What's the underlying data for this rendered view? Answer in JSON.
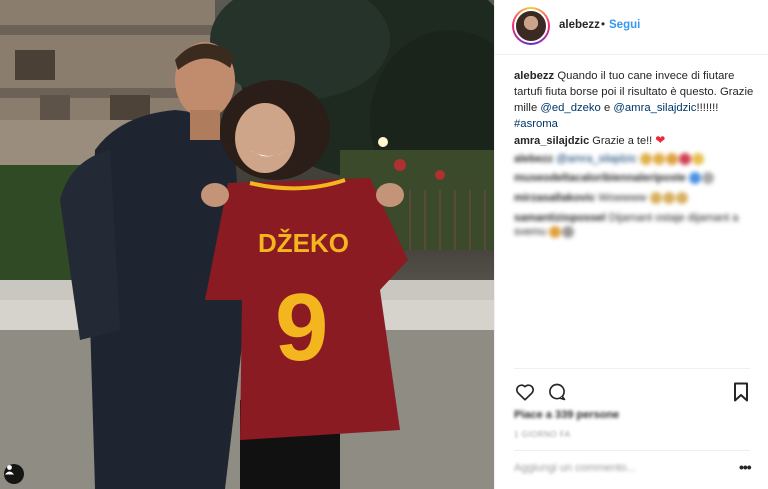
{
  "photo": {
    "jersey_name": "DŽEKO",
    "jersey_number": "9",
    "user_tag_icon": "person-icon"
  },
  "header": {
    "username": "alebezz",
    "separator": "•",
    "follow_label": "Segui"
  },
  "caption": {
    "username": "alebezz",
    "text_part1": "Quando il tuo cane invece di fiutare tartufi fiuta borse poi il risultato è questo. Grazie mille ",
    "mention1": "@ed_dzeko",
    "text_part2": " e ",
    "mention2": "@amra_silajdzic",
    "text_part3": "!!!!!!! ",
    "hashtag": "#asroma"
  },
  "comments": [
    {
      "username": "amra_silajdzic",
      "text": "Grazie a te!!",
      "emoji": "❤"
    },
    {
      "username": "alebezz",
      "text": "@amra_silajdzic",
      "blurred": true
    },
    {
      "username": "museodeltacaloribiennaleriposte",
      "text": "",
      "blurred": true
    },
    {
      "username": "mirzasallakovic",
      "text": "Wowwww",
      "blurred": true
    },
    {
      "username": "samantiziopossel",
      "text": "Dijamant ostaje dijamant a svemu",
      "blurred": true
    }
  ],
  "actions": {
    "like_icon": "heart-icon",
    "comment_icon": "comment-icon",
    "save_icon": "bookmark-icon"
  },
  "likes_text": "Piace a 339 persone",
  "time_text": "1 GIORNO FA",
  "add_comment_placeholder": "Aggiungi un commento...",
  "more_label": "•••",
  "colors": {
    "link": "#003569",
    "follow": "#3897f0",
    "jersey": "#8b1b22",
    "jersey_text": "#f3b61f"
  }
}
